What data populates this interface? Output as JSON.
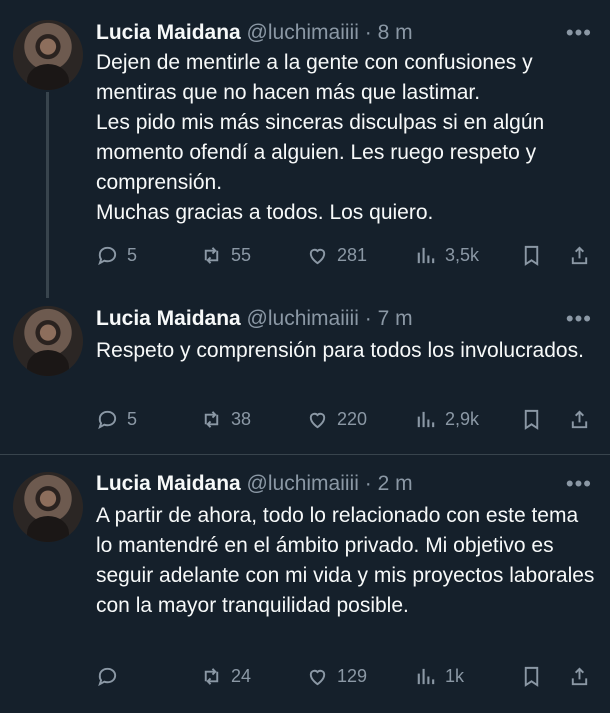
{
  "tweets": [
    {
      "name": "Lucia Maidana",
      "handle": "@luchimaiiii",
      "separator": "·",
      "time": "8 m",
      "more": "•••",
      "text": "Dejen de mentirle a la gente con confusiones y mentiras que no hacen más que lastimar.\nLes pido mis más sinceras disculpas si en algún momento ofendí a alguien. Les ruego respeto y comprensión.\nMuchas gracias a todos. Los quiero.",
      "replies": "5",
      "retweets": "55",
      "likes": "281",
      "views": "3,5k"
    },
    {
      "name": "Lucia Maidana",
      "handle": "@luchimaiiii",
      "separator": "·",
      "time": "7 m",
      "more": "•••",
      "text": "Respeto y comprensión para todos los involucrados.",
      "replies": "5",
      "retweets": "38",
      "likes": "220",
      "views": "2,9k"
    },
    {
      "name": "Lucia Maidana",
      "handle": "@luchimaiiii",
      "separator": "·",
      "time": "2 m",
      "more": "•••",
      "text": "A partir de ahora, todo lo relacionado con este tema lo mantendré en el ámbito privado. Mi objetivo es seguir adelante con mi vida y mis proyectos laborales con la mayor tranquilidad posible.",
      "replies": "",
      "retweets": "24",
      "likes": "129",
      "views": "1k"
    }
  ],
  "icons": {
    "reply": "reply-icon",
    "retweet": "retweet-icon",
    "like": "heart-icon",
    "views": "views-icon",
    "bookmark": "bookmark-icon",
    "share": "share-icon"
  },
  "colors": {
    "background": "#15202b",
    "text": "#f7f9f9",
    "muted": "#8b98a5",
    "divider": "#38444d"
  }
}
